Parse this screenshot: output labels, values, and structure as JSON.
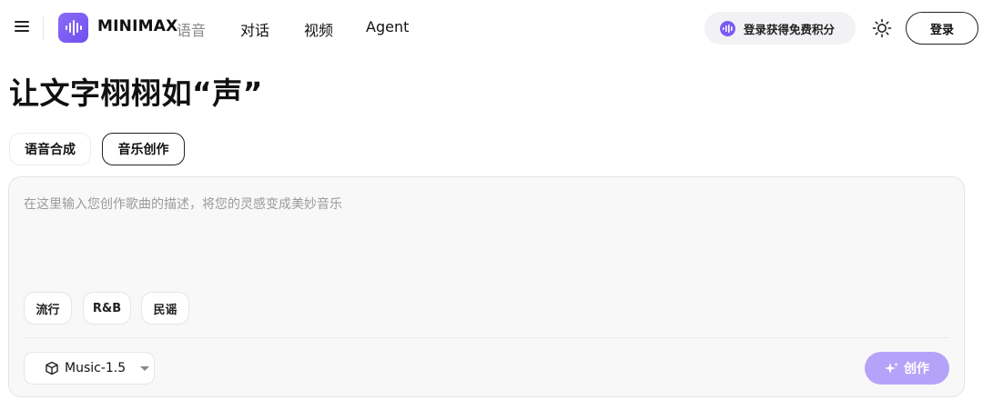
{
  "header": {
    "brand": "MINIMAX",
    "brand_sub": "语音",
    "nav": [
      {
        "label": "对话"
      },
      {
        "label": "视频"
      },
      {
        "label": "Agent"
      }
    ],
    "promo_label": "登录获得免费积分",
    "login_label": "登录"
  },
  "page": {
    "title": "让文字栩栩如“声”"
  },
  "tabs": [
    {
      "label": "语音合成",
      "active": false
    },
    {
      "label": "音乐创作",
      "active": true
    }
  ],
  "composer": {
    "placeholder": "在这里输入您创作歌曲的描述，将您的灵感变成美妙音乐",
    "value": "",
    "chips": [
      {
        "label": "流行"
      },
      {
        "label": "R&B"
      },
      {
        "label": "民谣"
      }
    ],
    "model": {
      "selected": "Music-1.5"
    },
    "create_label": "创作"
  },
  "colors": {
    "brand_purple": "#7a5cf4",
    "create_button": "#b5a3f9",
    "composer_bg": "#f8f8f9"
  },
  "icons": {
    "menu": "menu-icon",
    "logo": "waveform-logo-icon",
    "promo": "waveform-icon",
    "theme": "sun-icon",
    "model": "cube-icon",
    "model_caret": "caret-down-icon",
    "create": "sparkle-icon"
  }
}
